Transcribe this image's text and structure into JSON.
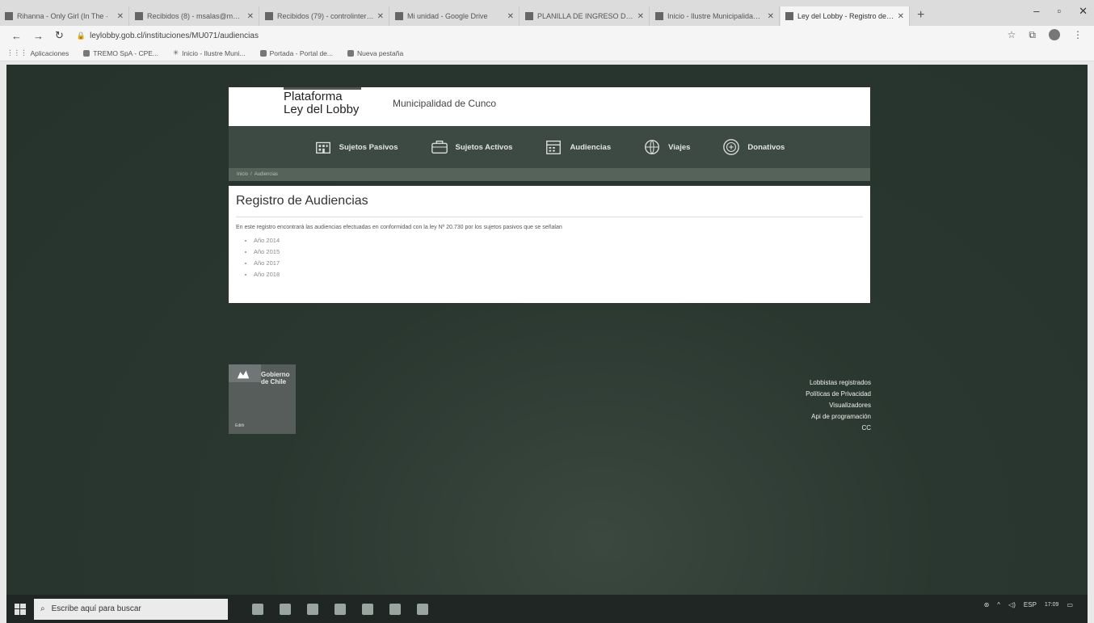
{
  "browser": {
    "tabs": [
      {
        "label": "Rihanna - Only Girl (In The ·"
      },
      {
        "label": "Recibidos (8) - msalas@munic"
      },
      {
        "label": "Recibidos (79) - controlinterno"
      },
      {
        "label": "Mi unidad - Google Drive"
      },
      {
        "label": "PLANILLA DE INGRESO DOCUM"
      },
      {
        "label": "Inicio - Ilustre Municipalidad de"
      },
      {
        "label": "Ley del Lobby - Registro de Au",
        "active": true
      }
    ],
    "url": "leylobby.gob.cl/instituciones/MU071/audiencias",
    "bookmarks": [
      {
        "label": "Aplicaciones"
      },
      {
        "label": "TREMO SpA - CPE..."
      },
      {
        "label": "Inicio - Ilustre Muni..."
      },
      {
        "label": "Portada - Portal de..."
      },
      {
        "label": "Nueva pestaña"
      }
    ]
  },
  "site": {
    "logo_line1": "Plataforma",
    "logo_line2": "Ley del Lobby",
    "institution": "Municipalidad de Cunco",
    "nav": [
      {
        "label": "Sujetos Pasivos",
        "icon": "building-icon"
      },
      {
        "label": "Sujetos Activos",
        "icon": "briefcase-icon"
      },
      {
        "label": "Audiencias",
        "icon": "calendar-icon"
      },
      {
        "label": "Viajes",
        "icon": "globe-icon"
      },
      {
        "label": "Donativos",
        "icon": "gift-icon"
      }
    ],
    "breadcrumb": [
      "Inicio",
      "Audiencias"
    ],
    "breadcrumb_sep": "/"
  },
  "content": {
    "title": "Registro de Audiencias",
    "intro": "En este registro encontrará las audiencias efectuadas en conformidad con la ley Nº 20.730 por los sujetos pasivos que se señalan",
    "years": [
      "Año 2014",
      "Año 2015",
      "Año 2017",
      "Año 2018"
    ]
  },
  "footer": {
    "gob_line1": "Gobierno",
    "gob_line2": "de Chile",
    "gob_small": "Edith",
    "links": [
      "Lobbistas registrados",
      "Políticas de Privacidad",
      "Visualizadores",
      "Api de programación",
      "CC"
    ]
  },
  "taskbar": {
    "search_placeholder": "Escribe aquí para buscar",
    "lang": "ESP",
    "time": "17:09"
  }
}
